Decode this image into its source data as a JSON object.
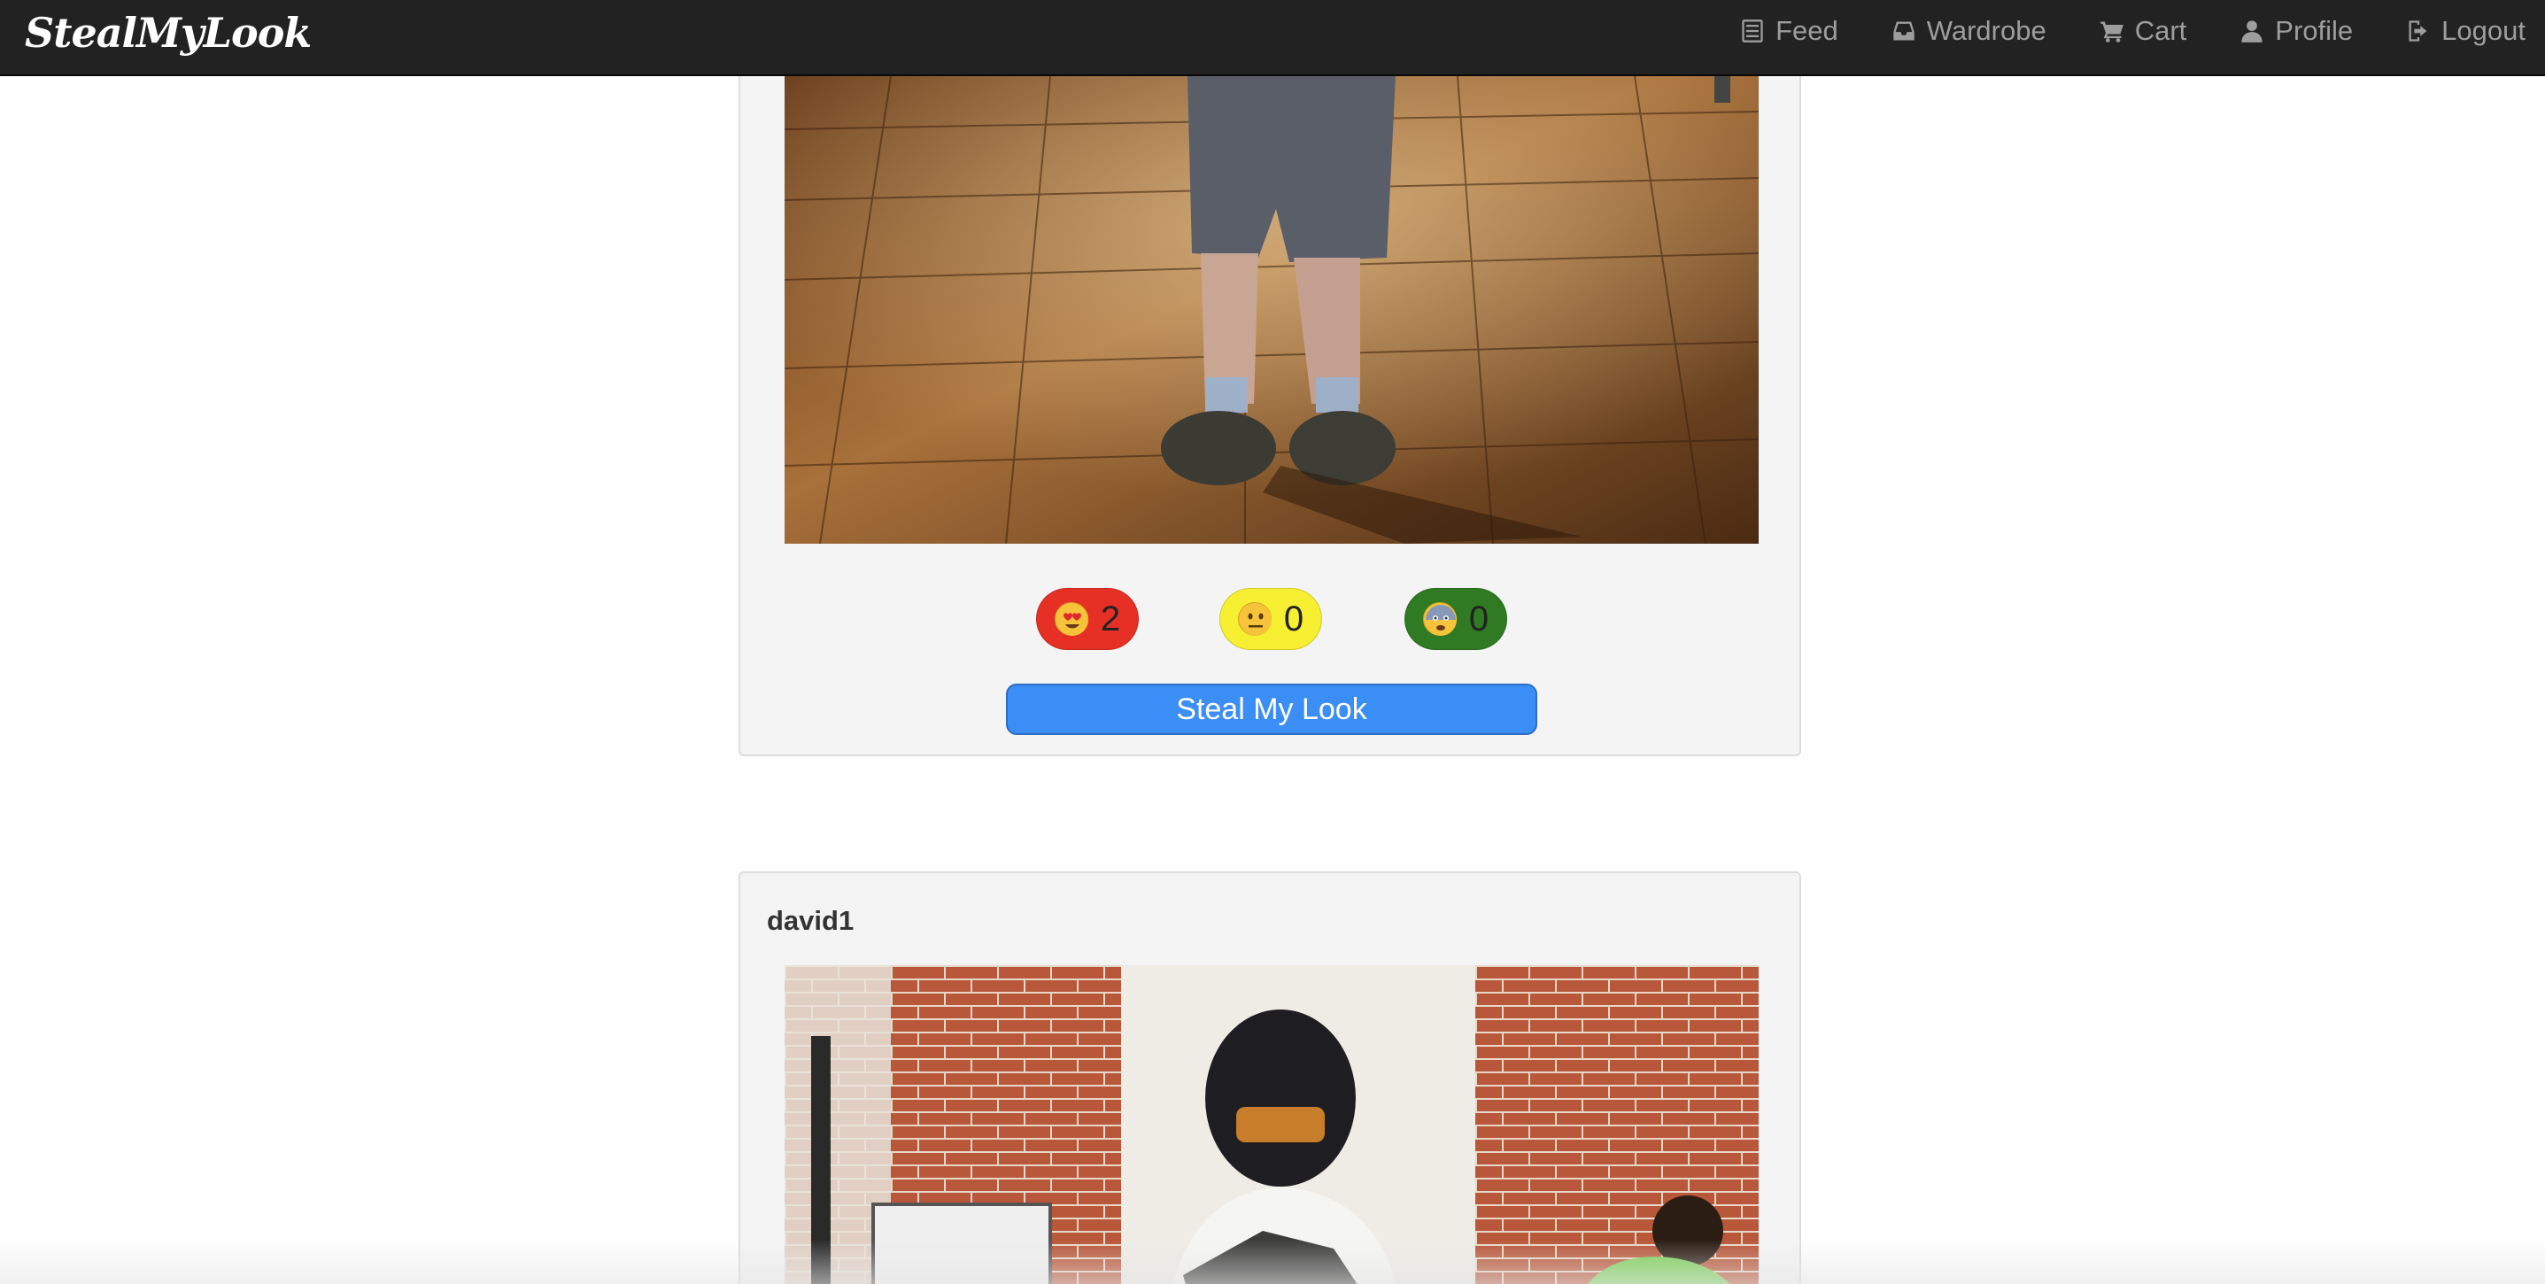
{
  "brand": {
    "name": "StealMyLook"
  },
  "nav": {
    "items": [
      {
        "label": "Feed",
        "icon": "list-icon"
      },
      {
        "label": "Wardrobe",
        "icon": "inbox-icon"
      },
      {
        "label": "Cart",
        "icon": "cart-icon"
      },
      {
        "label": "Profile",
        "icon": "user-icon"
      },
      {
        "label": "Logout",
        "icon": "logout-icon"
      }
    ]
  },
  "posts": [
    {
      "reactions": {
        "love": {
          "count": "2",
          "icon": "heart-eyes-emoji",
          "color": "#e63025"
        },
        "meh": {
          "count": "0",
          "icon": "neutral-face-emoji",
          "color": "#f7ef32"
        },
        "fear": {
          "count": "0",
          "icon": "fearful-face-emoji",
          "color": "#2f7a23"
        }
      },
      "action_label": "Steal My Look"
    },
    {
      "username": "david1"
    }
  ],
  "colors": {
    "navbar": "#222222",
    "nav_text": "#9d9d9d",
    "panel_bg": "#f4f4f4",
    "button": "#3c8ef7"
  }
}
